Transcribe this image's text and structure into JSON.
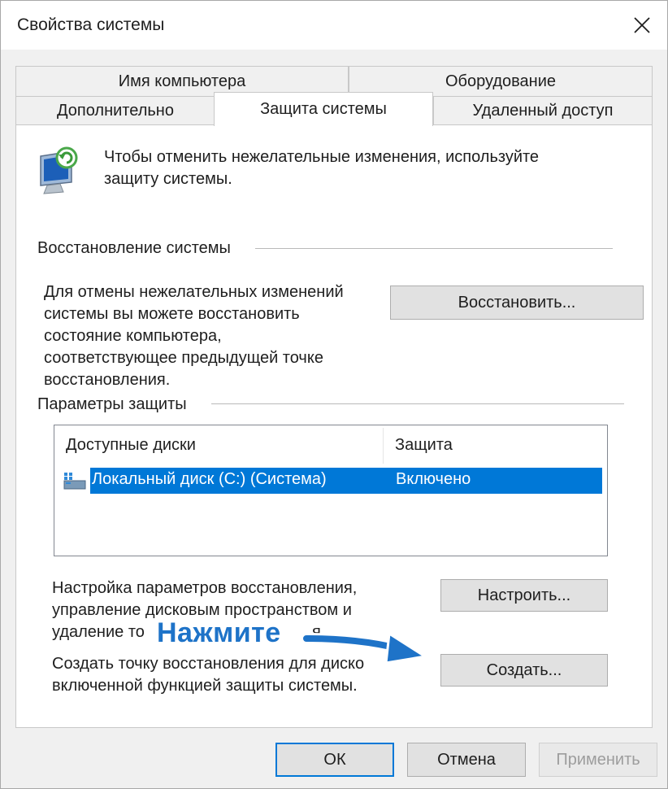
{
  "window": {
    "title": "Свойства системы"
  },
  "tabs": {
    "row1": [
      "Имя компьютера",
      "Оборудование"
    ],
    "row2": [
      "Дополнительно",
      "Защита системы",
      "Удаленный доступ"
    ],
    "active": "Защита системы"
  },
  "intro": {
    "icon": "system-protection-icon",
    "line1": "Чтобы отменить нежелательные изменения, используйте",
    "line2": "защиту системы."
  },
  "restore": {
    "group_label": "Восстановление системы",
    "desc_lines": [
      "Для отмены нежелательных изменений",
      "системы вы можете восстановить",
      "состояние компьютера,",
      "соответствующее предыдущей точке",
      "восстановления."
    ],
    "button_label": "Восстановить..."
  },
  "protection": {
    "group_label": "Параметры защиты",
    "columns": [
      "Доступные диски",
      "Защита"
    ],
    "rows": [
      {
        "disk": "Локальный диск (C:) (Система)",
        "status": "Включено",
        "icon": "drive-icon",
        "selected": true
      }
    ],
    "configure_lines": [
      "Настройка параметров восстановления,",
      "управление дисковым пространством и",
      "удаление то",
      "я."
    ],
    "configure_button": "Настроить...",
    "create_lines": [
      "Создать точку восстановления для диско",
      "включенной функцией защиты системы."
    ],
    "create_button": "Создать..."
  },
  "annotation": {
    "text": "Нажмите",
    "color": "#1e73c8"
  },
  "footer": {
    "ok": "ОК",
    "cancel": "Отмена",
    "apply": "Применить"
  },
  "colors": {
    "accent": "#0078d7",
    "selection": "#0078d7"
  }
}
